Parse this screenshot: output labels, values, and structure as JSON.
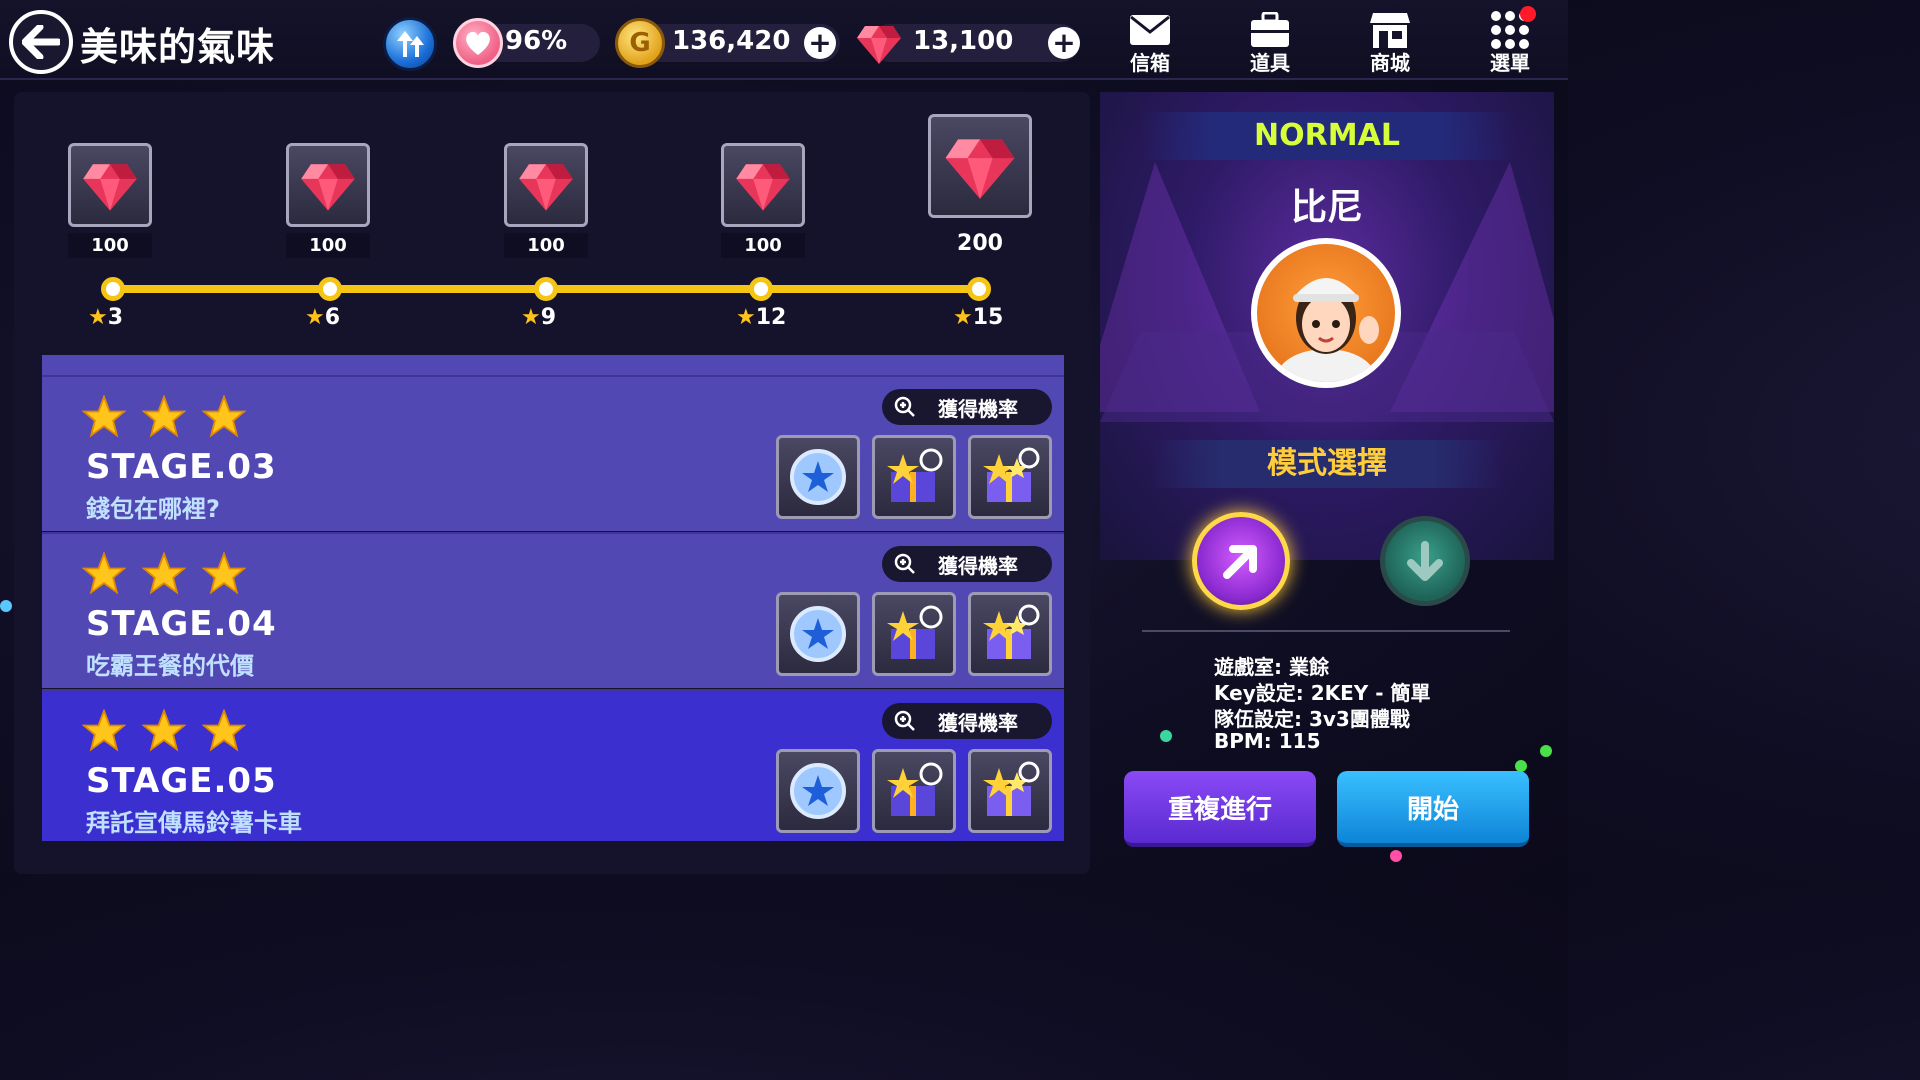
{
  "header": {
    "title": "美味的氣味",
    "heart_value": "96%",
    "gold_value": "136,420",
    "gem_value": "13,100",
    "coin_glyph": "G",
    "nav": [
      {
        "label": "信箱",
        "icon": "mail-icon"
      },
      {
        "label": "道具",
        "icon": "briefcase-icon"
      },
      {
        "label": "商城",
        "icon": "shop-icon"
      },
      {
        "label": "選單",
        "icon": "menu-grid-icon"
      }
    ]
  },
  "rewards": [
    {
      "amount": "100",
      "stars": "3"
    },
    {
      "amount": "100",
      "stars": "6"
    },
    {
      "amount": "100",
      "stars": "9"
    },
    {
      "amount": "100",
      "stars": "12"
    },
    {
      "amount": "200",
      "stars": "15"
    }
  ],
  "prob_label": "獲得機率",
  "stages": [
    {
      "name": "STAGE.03",
      "subtitle": "錢包在哪裡?",
      "stars": 3
    },
    {
      "name": "STAGE.04",
      "subtitle": "吃霸王餐的代價",
      "stars": 3
    },
    {
      "name": "STAGE.05",
      "subtitle": "拜託宣傳馬鈴薯卡車",
      "stars": 3
    }
  ],
  "right": {
    "difficulty": "NORMAL",
    "character": "比尼",
    "mode_title": "模式選擇",
    "info": [
      "遊戲室: 業餘",
      "Key設定: 2KEY - 簡單",
      "隊伍設定: 3v3團體戰",
      "BPM: 115"
    ],
    "repeat_label": "重複進行",
    "start_label": "開始"
  },
  "colors": {
    "accent_gold": "#f5c515",
    "normal_text": "#d6ff3a",
    "mode_text": "#ffcc3a",
    "stage_row": "#5248b4",
    "stage_active": "#3b2fd0",
    "repeat_btn": "#6a3ce0",
    "start_btn": "#1aa0e8"
  }
}
